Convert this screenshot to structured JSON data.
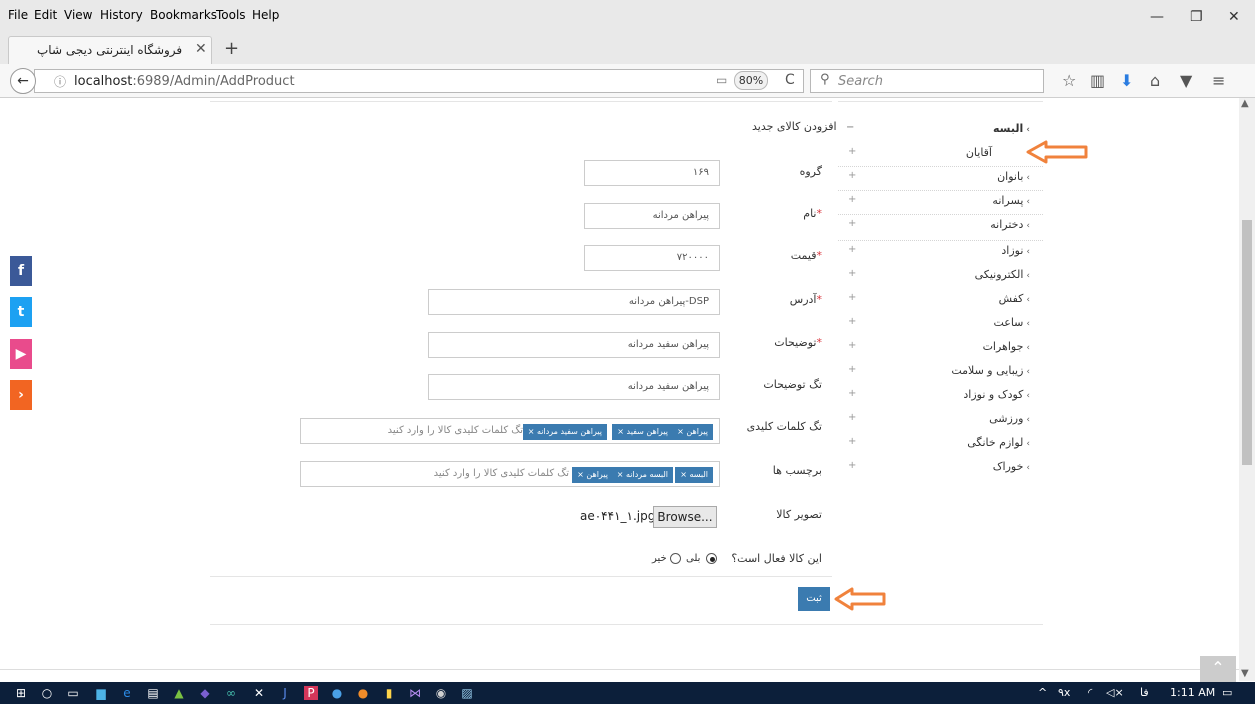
{
  "menubar": {
    "items": [
      "File",
      "Edit",
      "View",
      "History",
      "Bookmarks",
      "Tools",
      "Help"
    ],
    "underline_chars": [
      "F",
      "E",
      "V",
      "s",
      "B",
      "T",
      "H"
    ],
    "minimize": "—",
    "restore": "❐",
    "close": "✕"
  },
  "tab": {
    "title": "فروشگاه اینترنتی دیجی شاپ",
    "close": "✕",
    "new_tab": "+"
  },
  "nav": {
    "back": "←",
    "info": "ⓘ",
    "url_host": "localhost",
    "url_rest": ":6989/Admin/AddProduct",
    "zoom": "80%",
    "reload": "C",
    "search_placeholder": "Search"
  },
  "toolbar_icons": {
    "star": "☆",
    "library": "▥",
    "download": "⬇",
    "home": "⌂",
    "pocket": "▼",
    "menu": "≡"
  },
  "social": [
    {
      "icon": "f",
      "color": "#3b5998"
    },
    {
      "icon": "t",
      "color": "#1da1f2"
    },
    {
      "icon": "▶",
      "color": "#e94b8c"
    },
    {
      "icon": "›",
      "color": "#f26522"
    }
  ],
  "form": {
    "title": "افزودن کالای جدید",
    "group_label": "گروه",
    "group_value": "۱۶۹",
    "name_label": "نام",
    "name_value": "پیراهن مردانه",
    "price_label": "قیمت",
    "price_value": "۷۲۰۰۰۰",
    "address_label": "آدرس",
    "address_value": "DSP-پیراهن مردانه",
    "desc_label": "توضیحات",
    "desc_value": "پیراهن سفید مردانه",
    "tagdesc_label": "تگ توضیحات",
    "tagdesc_value": "پیراهن سفید مردانه",
    "keywords_label": "تگ کلمات کلیدی",
    "keywords_tags": [
      "پیراهن ×",
      "پیراهن سفید ×",
      "پیراهن سفید مردانه ×"
    ],
    "keywords_placeholder": "تگ کلمات کلیدی کالا را وارد کنید",
    "labels_label": "برچسب ها",
    "labels_tags": [
      "البسه ×",
      "البسه مردانه ×",
      "پیراهن ×"
    ],
    "labels_placeholder": "تگ کلمات کلیدی کالا را وارد کنید",
    "image_label": "تصویر کالا",
    "browse": "Browse...",
    "file_name": "ae۰۴۴۱_۱.jpg",
    "active_label": "این کالا فعال است؟",
    "yes": "بلی",
    "no": "خیر",
    "submit": "ثبت"
  },
  "categories": [
    "البسه",
    "آقایان",
    "بانوان",
    "پسرانه",
    "دخترانه",
    "نوزاد",
    "الکترونیکی",
    "کفش",
    "ساعت",
    "جواهرات",
    "زیبایی و سلامت",
    "کودک و نوزاد",
    "ورزشی",
    "لوازم خانگی",
    "خوراک"
  ],
  "category_plus": "+",
  "category_minus": "−",
  "taskbar": {
    "time": "1:11 AM",
    "lang": "فا",
    "tray_up": "^",
    "tray_num": "۹x",
    "volume": "◁×"
  },
  "colors": {
    "accent": "#3b7bb0",
    "arrow": "#f0823c",
    "taskbar": "#0c1f3a"
  }
}
